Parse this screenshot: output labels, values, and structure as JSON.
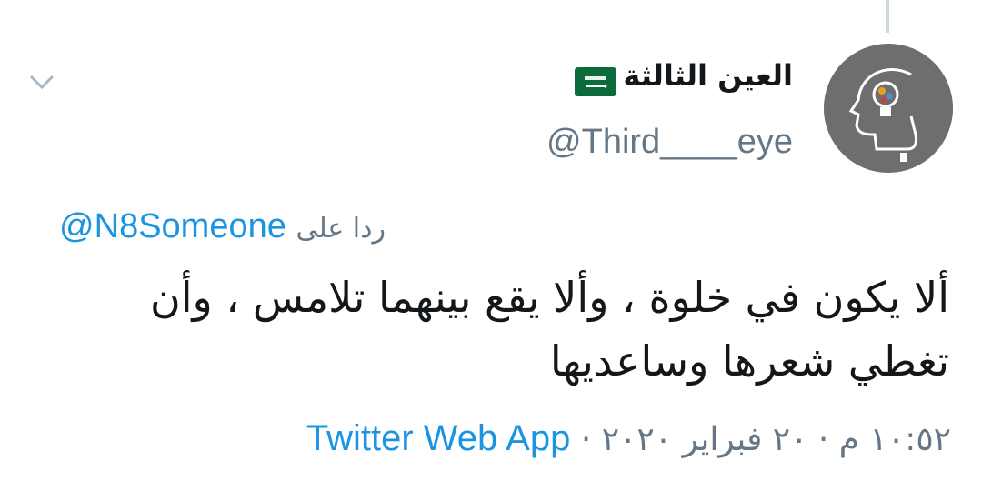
{
  "tweet": {
    "display_name": "العين الثالثة",
    "handle": "@Third____eye",
    "reply_label": "ردا على",
    "reply_to": "@N8Someone",
    "text": "ألا يكون في خلوة ، وألا يقع بينهما تلامس ، وأن تغطي شعرها وساعديها",
    "timestamp": "١٠:٥٢ م · ٢٠ فبراير ٢٠٢٠",
    "separator": "·",
    "source": "Twitter Web App"
  },
  "icons": {
    "flag": "saudi-flag-icon",
    "menu": "chevron-down-icon",
    "avatar": "head-lightbulb-avatar"
  },
  "colors": {
    "link": "#1b95e0",
    "muted": "#657786",
    "text": "#14171a",
    "flag_green": "#0b6b3a"
  }
}
